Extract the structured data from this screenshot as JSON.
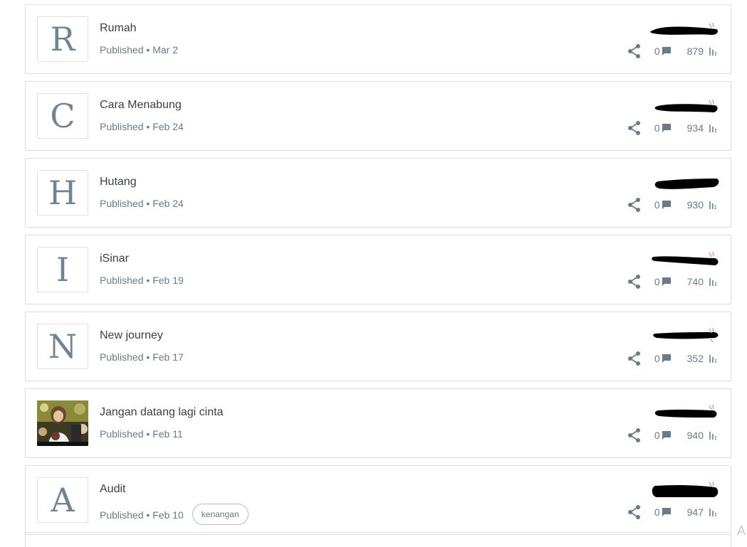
{
  "posts": [
    {
      "thumb_letter": "R",
      "title": "Rumah",
      "status": "Published",
      "date": "Mar 2",
      "comments": "0",
      "views": "879",
      "label": ""
    },
    {
      "thumb_letter": "C",
      "title": "Cara Menabung",
      "status": "Published",
      "date": "Feb 24",
      "comments": "0",
      "views": "934",
      "label": ""
    },
    {
      "thumb_letter": "H",
      "title": "Hutang",
      "status": "Published",
      "date": "Feb 24",
      "comments": "0",
      "views": "930",
      "label": ""
    },
    {
      "thumb_letter": "I",
      "title": "iSinar",
      "status": "Published",
      "date": "Feb 19",
      "comments": "0",
      "views": "740",
      "label": ""
    },
    {
      "thumb_letter": "N",
      "title": "New journey",
      "status": "Published",
      "date": "Feb 17",
      "comments": "0",
      "views": "352",
      "label": ""
    },
    {
      "thumb_letter": "",
      "title": "Jangan datang lagi cinta",
      "status": "Published",
      "date": "Feb 11",
      "comments": "0",
      "views": "940",
      "label": ""
    },
    {
      "thumb_letter": "A",
      "title": "Audit",
      "status": "Published",
      "date": "Feb 10",
      "comments": "0",
      "views": "947",
      "label": "kenangan"
    }
  ],
  "separator": " • ",
  "corner_letter": "A",
  "icons": {
    "share": "share-icon",
    "comment": "comment-icon",
    "views": "bar-chart-icon"
  },
  "colors": {
    "text_primary": "#3c4043",
    "text_secondary": "#6b7b86",
    "border": "#dadce0",
    "redaction": "#000000"
  }
}
